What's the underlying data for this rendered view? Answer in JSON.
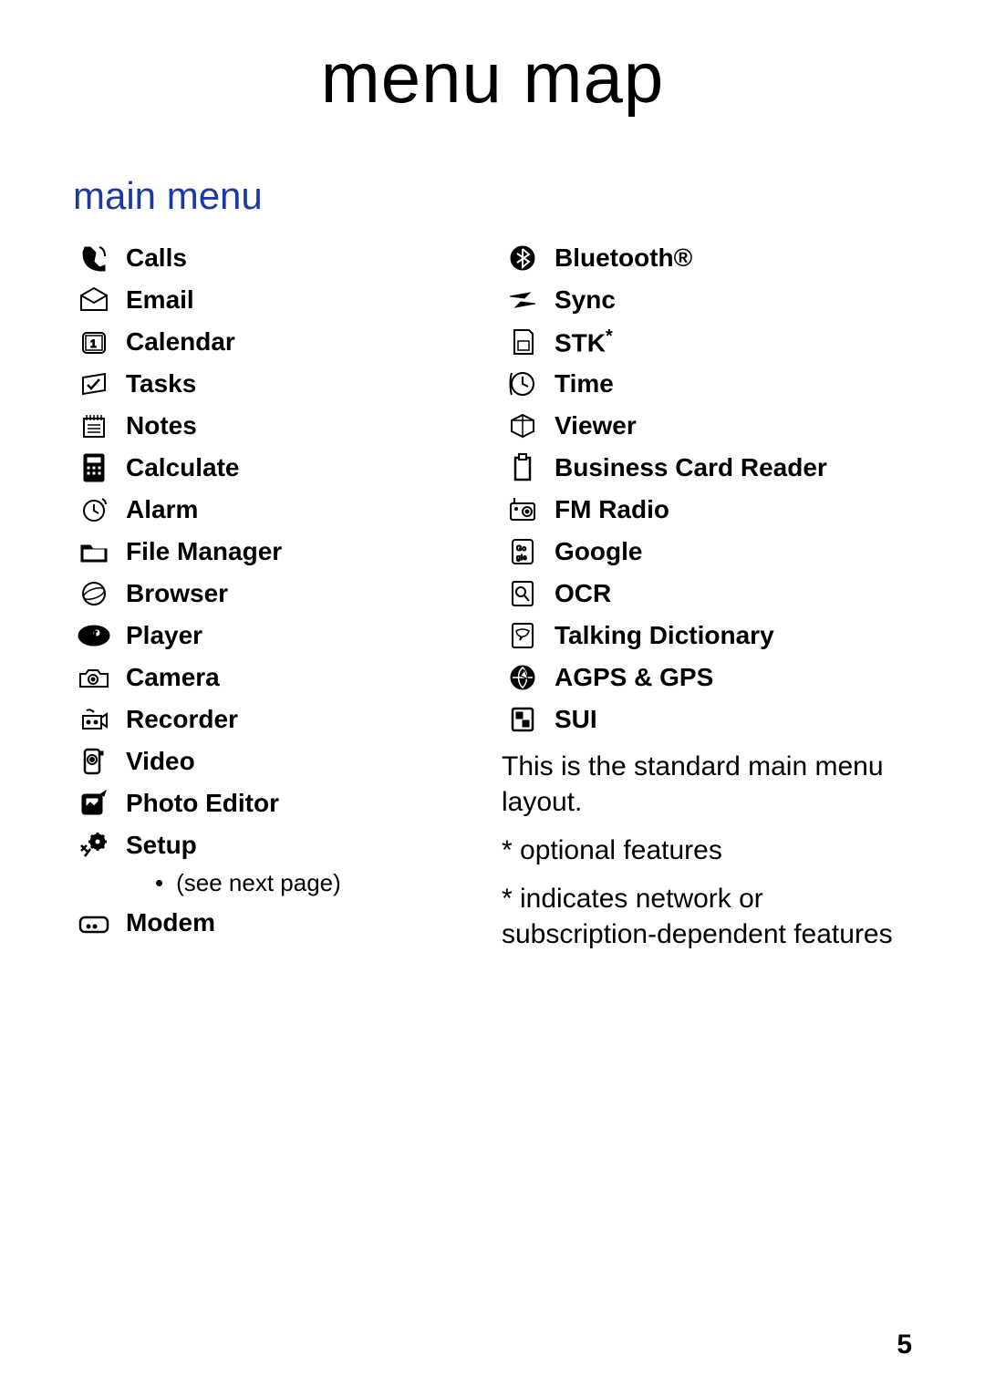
{
  "title": "menu map",
  "section_title": "main menu",
  "left": [
    {
      "icon": "calls-icon",
      "label": "Calls"
    },
    {
      "icon": "email-icon",
      "label": "Email"
    },
    {
      "icon": "calendar-icon",
      "label": "Calendar"
    },
    {
      "icon": "tasks-icon",
      "label": "Tasks"
    },
    {
      "icon": "notes-icon",
      "label": "Notes"
    },
    {
      "icon": "calculate-icon",
      "label": "Calculate"
    },
    {
      "icon": "alarm-icon",
      "label": "Alarm"
    },
    {
      "icon": "filemanager-icon",
      "label": "File Manager"
    },
    {
      "icon": "browser-icon",
      "label": "Browser"
    },
    {
      "icon": "player-icon",
      "label": "Player"
    },
    {
      "icon": "camera-icon",
      "label": "Camera"
    },
    {
      "icon": "recorder-icon",
      "label": "Recorder"
    },
    {
      "icon": "video-icon",
      "label": "Video"
    },
    {
      "icon": "photoeditor-icon",
      "label": "Photo Editor"
    },
    {
      "icon": "setup-icon",
      "label": "Setup",
      "sub": "(see next page)"
    },
    {
      "icon": "modem-icon",
      "label": "Modem"
    }
  ],
  "right": [
    {
      "icon": "bluetooth-icon",
      "label": "Bluetooth®"
    },
    {
      "icon": "sync-icon",
      "label": "Sync"
    },
    {
      "icon": "stk-icon",
      "label": "STK",
      "sup": "*"
    },
    {
      "icon": "time-icon",
      "label": "Time"
    },
    {
      "icon": "viewer-icon",
      "label": "Viewer"
    },
    {
      "icon": "businesscard-icon",
      "label": "Business Card Reader"
    },
    {
      "icon": "fmradio-icon",
      "label": "FM Radio"
    },
    {
      "icon": "google-icon",
      "label": "Google"
    },
    {
      "icon": "ocr-icon",
      "label": "OCR"
    },
    {
      "icon": "talkingdict-icon",
      "label": "Talking Dictionary"
    },
    {
      "icon": "agps-icon",
      "label": "AGPS & GPS"
    },
    {
      "icon": "sui-icon",
      "label": "SUI"
    }
  ],
  "footnotes": [
    "This is the standard main menu layout.",
    "* optional features",
    "* indicates network or subscription-dependent features"
  ],
  "page_number": "5"
}
